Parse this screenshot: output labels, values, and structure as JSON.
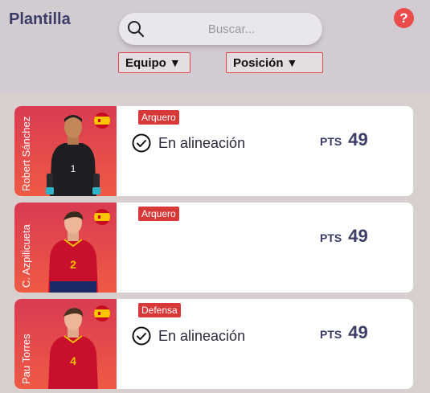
{
  "header": {
    "title": "Plantilla",
    "help_label": "?",
    "search_placeholder": "Buscar...",
    "filters": [
      {
        "label": "Equipo",
        "arrow": "▼"
      },
      {
        "label": "Posición",
        "arrow": "▼"
      }
    ]
  },
  "colors": {
    "accent": "#e14848",
    "title": "#3b3c66",
    "tag": "#d73939"
  },
  "players": [
    {
      "name": "Robert Sánchez",
      "position": "Arquero",
      "lineup_text": "En alineación",
      "in_lineup": true,
      "pts_label": "PTS",
      "points": "49",
      "shirt_number": "1",
      "kit": "goalkeeper"
    },
    {
      "name": "C. Azpilicueta",
      "position": "Arquero",
      "lineup_text": "",
      "in_lineup": false,
      "pts_label": "PTS",
      "points": "49",
      "shirt_number": "2",
      "kit": "field"
    },
    {
      "name": "Pau Torres",
      "position": "Defensa",
      "lineup_text": "En alineación",
      "in_lineup": true,
      "pts_label": "PTS",
      "points": "49",
      "shirt_number": "4",
      "kit": "field"
    }
  ]
}
